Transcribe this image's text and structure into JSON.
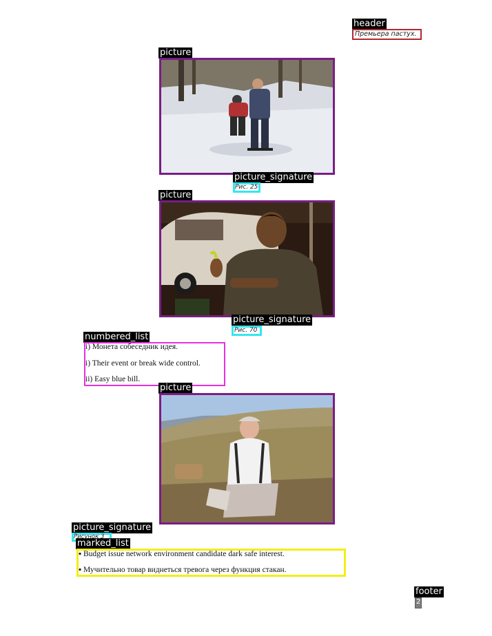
{
  "labels": {
    "header": "header",
    "picture": "picture",
    "picture_signature": "picture_signature",
    "numbered_list": "numbered_list",
    "marked_list": "marked_list",
    "footer": "footer"
  },
  "header": {
    "text": "Премьера пастух."
  },
  "figures": [
    {
      "caption": "Рис. 25"
    },
    {
      "caption": "Рис. 70"
    },
    {
      "caption": "Рисунок 3"
    }
  ],
  "numbered_list": {
    "items": [
      "i) Монета собеседник идея.",
      "i) Their event or break wide control.",
      "ii) Easy blue bill."
    ]
  },
  "marked_list": {
    "items": [
      "Budget issue network environment candidate dark safe interest.",
      "Мучительно товар виднеться тревога через функция стакан."
    ]
  },
  "footer": {
    "page_number": "2"
  },
  "colors": {
    "header_box": "#b5262c",
    "picture_box": "#7a1d86",
    "caption_box": "#35e6ee",
    "numbered_box": "#e52fe0",
    "marked_box": "#f2ee16",
    "footer_box": "#7f7f7f"
  }
}
